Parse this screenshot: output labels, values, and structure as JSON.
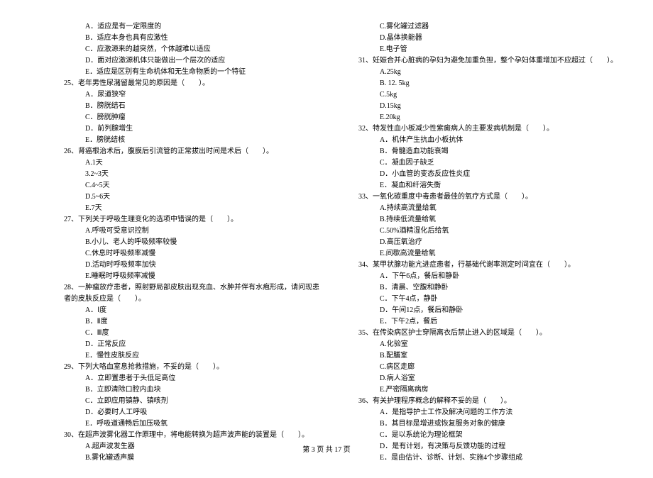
{
  "left_column": [
    {
      "type": "option",
      "text": "A．适应是有一定限度的"
    },
    {
      "type": "option",
      "text": "B．适应本身也具有应激性"
    },
    {
      "type": "option",
      "text": "C．应激源来的越突然，个体越难以适应"
    },
    {
      "type": "option",
      "text": "D．面对应激源机体只能做出一个层次的适应"
    },
    {
      "type": "option",
      "text": "E．适应是区别有生命机体和无生命物质的一个特征"
    },
    {
      "type": "question",
      "text": "25、老年男性尿潴留最常见的原因是（　　）。"
    },
    {
      "type": "option",
      "text": "A．尿道狭窄"
    },
    {
      "type": "option",
      "text": "B．膀胱结石"
    },
    {
      "type": "option",
      "text": "C．膀胱肿瘤"
    },
    {
      "type": "option",
      "text": "D．前列腺增生"
    },
    {
      "type": "option",
      "text": "E．膀胱结核"
    },
    {
      "type": "question",
      "text": "26、肾癌根治术后，腹膜后引流管的正常拔出时间是术后（　　）。"
    },
    {
      "type": "option",
      "text": "A.1天"
    },
    {
      "type": "option",
      "text": "3.2~3天"
    },
    {
      "type": "option",
      "text": "C.4~5天"
    },
    {
      "type": "option",
      "text": "D.5~6天"
    },
    {
      "type": "option",
      "text": "E.7天"
    },
    {
      "type": "question",
      "text": "27、下列关于呼吸生理变化的选项中错误的是（　　）。"
    },
    {
      "type": "option",
      "text": "A.呼吸可受意识控制"
    },
    {
      "type": "option",
      "text": "B.小儿、老人的呼吸频率较慢"
    },
    {
      "type": "option",
      "text": "C.休息时呼吸频率减慢"
    },
    {
      "type": "option",
      "text": "D.活动时呼吸频率加快"
    },
    {
      "type": "option",
      "text": "E.睡眠时呼吸频率减慢"
    },
    {
      "type": "question",
      "text": "28、一肿瘤放疗患者，照射野局部皮肤出现充血、水肿并伴有水疱形成，请问现患者的皮肤反应是（　　）。"
    },
    {
      "type": "option",
      "text": "A．Ⅰ度"
    },
    {
      "type": "option",
      "text": "B．Ⅱ度"
    },
    {
      "type": "option",
      "text": "C．Ⅲ度"
    },
    {
      "type": "option",
      "text": "D．正常反应"
    },
    {
      "type": "option",
      "text": "E．慢性皮肤反应"
    },
    {
      "type": "question",
      "text": "29、下列大咯血室息抢救措施，不妥的是（　　）。"
    },
    {
      "type": "option",
      "text": "A．立即置患者于头低足高位"
    },
    {
      "type": "option",
      "text": "B．立即清除口腔内血块"
    },
    {
      "type": "option",
      "text": "C．立即应用镇静、镇咳剂"
    },
    {
      "type": "option",
      "text": "D．必要时人工呼吸"
    },
    {
      "type": "option",
      "text": "E．呼吸道通畅后加压吸氧"
    },
    {
      "type": "question",
      "text": "30、在超声波雾化器工作原理中，将电能转换为超声波声能的装置是（　　）。"
    },
    {
      "type": "option",
      "text": "A.超声波发生器"
    },
    {
      "type": "option",
      "text": "B.雾化罐透声膜"
    }
  ],
  "right_column": [
    {
      "type": "option",
      "text": "C.雾化罐过滤器"
    },
    {
      "type": "option",
      "text": "D.晶体换能器"
    },
    {
      "type": "option",
      "text": "E.电子管"
    },
    {
      "type": "question",
      "text": "31、妊娠合并心脏病的孕妇为避免加重负担，整个孕妇体重增加不应超过（　　）。"
    },
    {
      "type": "option",
      "text": "A.25kg"
    },
    {
      "type": "option",
      "text": "B. 12. 5kg"
    },
    {
      "type": "option",
      "text": "C.5kg"
    },
    {
      "type": "option",
      "text": "D.15kg"
    },
    {
      "type": "option",
      "text": "E.20kg"
    },
    {
      "type": "question",
      "text": "32、特发性血小板减少性紫癜病人的主要发病机制是（　　）。"
    },
    {
      "type": "option",
      "text": "A．机体产生抗血小板抗体"
    },
    {
      "type": "option",
      "text": "B．骨髓造血功能衰竭"
    },
    {
      "type": "option",
      "text": "C．凝血因子缺乏"
    },
    {
      "type": "option",
      "text": "D．小血管的变态反应性炎症"
    },
    {
      "type": "option",
      "text": "E．凝血和纤溶失衡"
    },
    {
      "type": "question",
      "text": "33、一氧化碳重度中毒患者最佳的氧疗方式是（　　）。"
    },
    {
      "type": "option",
      "text": "A.持续高流量给氧"
    },
    {
      "type": "option",
      "text": "B.持续低流量给氧"
    },
    {
      "type": "option",
      "text": "C.50%酒精湿化后给氧"
    },
    {
      "type": "option",
      "text": "D.高压氧治疗"
    },
    {
      "type": "option",
      "text": "E.间歇高流量给氧"
    },
    {
      "type": "question",
      "text": "34、某甲状腺功能亢进症患者，行基础代谢率测定时间宜在（　　）。"
    },
    {
      "type": "option",
      "text": "A．下午6点，餐后和静卧"
    },
    {
      "type": "option",
      "text": "B．清晨、空腹和静卧"
    },
    {
      "type": "option",
      "text": "C．下午4点，静卧"
    },
    {
      "type": "option",
      "text": "D．午间12点，餐后和静卧"
    },
    {
      "type": "option",
      "text": "E．下午2点，餐后"
    },
    {
      "type": "question",
      "text": "35、在传染病区护士穿隔离衣后禁止进入的区域是（　　）。"
    },
    {
      "type": "option",
      "text": "A.化验室"
    },
    {
      "type": "option",
      "text": "B.配膳室"
    },
    {
      "type": "option",
      "text": "C.病区走廊"
    },
    {
      "type": "option",
      "text": "D.病人浴室"
    },
    {
      "type": "option",
      "text": "E.严密隔离病房"
    },
    {
      "type": "question",
      "text": "36、有关护理程序概念的解释不妥的是（　　）。"
    },
    {
      "type": "option",
      "text": "A．是指导护士工作及解决问题的工作方法"
    },
    {
      "type": "option",
      "text": "B．其目标是增进或恢复服务对象的健康"
    },
    {
      "type": "option",
      "text": "C．是以系统论为理论框架"
    },
    {
      "type": "option",
      "text": "D．是有计划，有决策与反馈功能的过程"
    },
    {
      "type": "option",
      "text": "E．是由估计、诊断、计划、实施4个步骤组成"
    }
  ],
  "footer": "第 3 页 共 17 页"
}
